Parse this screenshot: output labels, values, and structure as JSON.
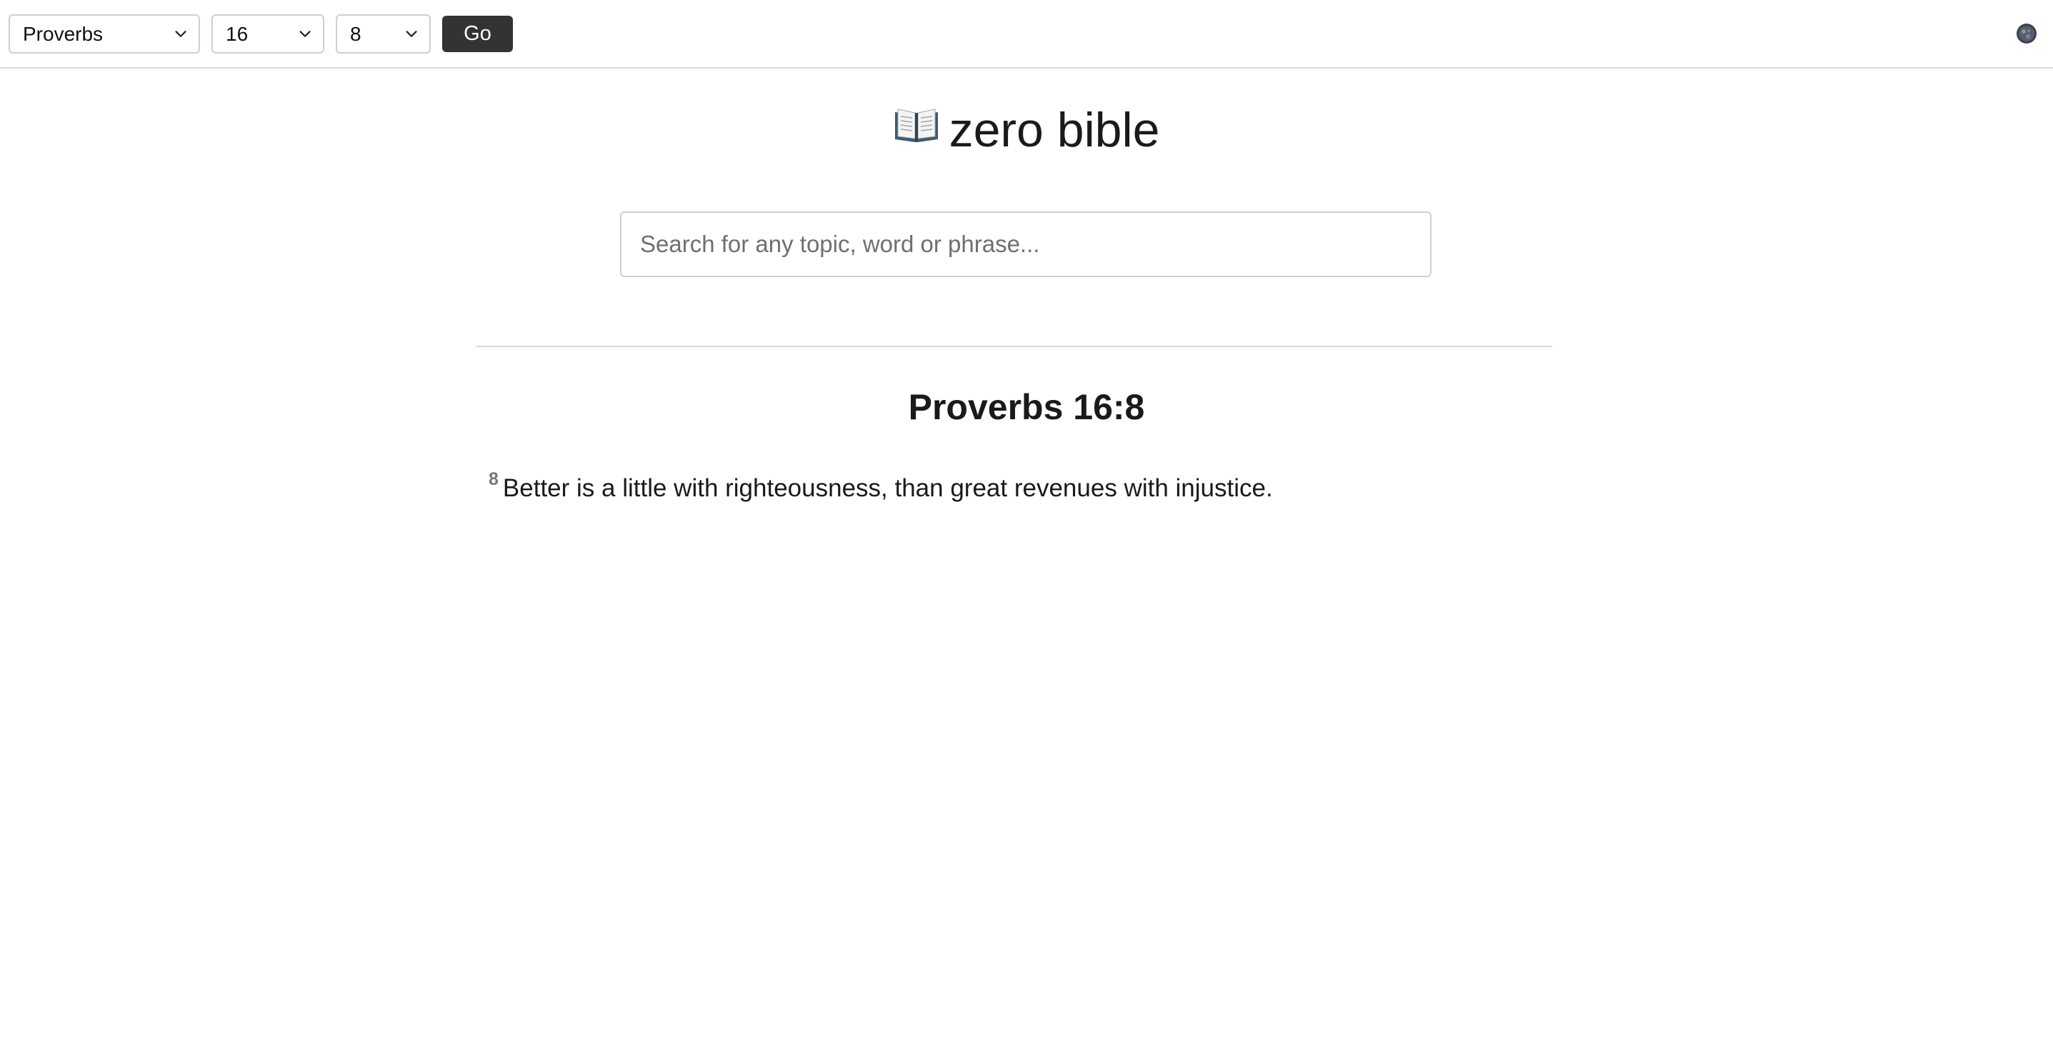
{
  "nav": {
    "book": {
      "selected": "Proverbs"
    },
    "chapter": {
      "selected": "16"
    },
    "verse": {
      "selected": "8"
    },
    "go_label": "Go",
    "theme_toggle_icon": "dark-mode-icon"
  },
  "header": {
    "icon": "open-book-icon",
    "title": "zero bible"
  },
  "search": {
    "placeholder": "Search for any topic, word or phrase...",
    "value": ""
  },
  "passage": {
    "reference": "Proverbs 16:8",
    "verses": [
      {
        "number": "8",
        "text": "Better is a little with righteousness, than great revenues with injustice."
      }
    ]
  },
  "colors": {
    "button_bg": "#333333",
    "border": "#cfcfcf",
    "divider": "#d8d8d8",
    "verse_number": "#777777"
  }
}
